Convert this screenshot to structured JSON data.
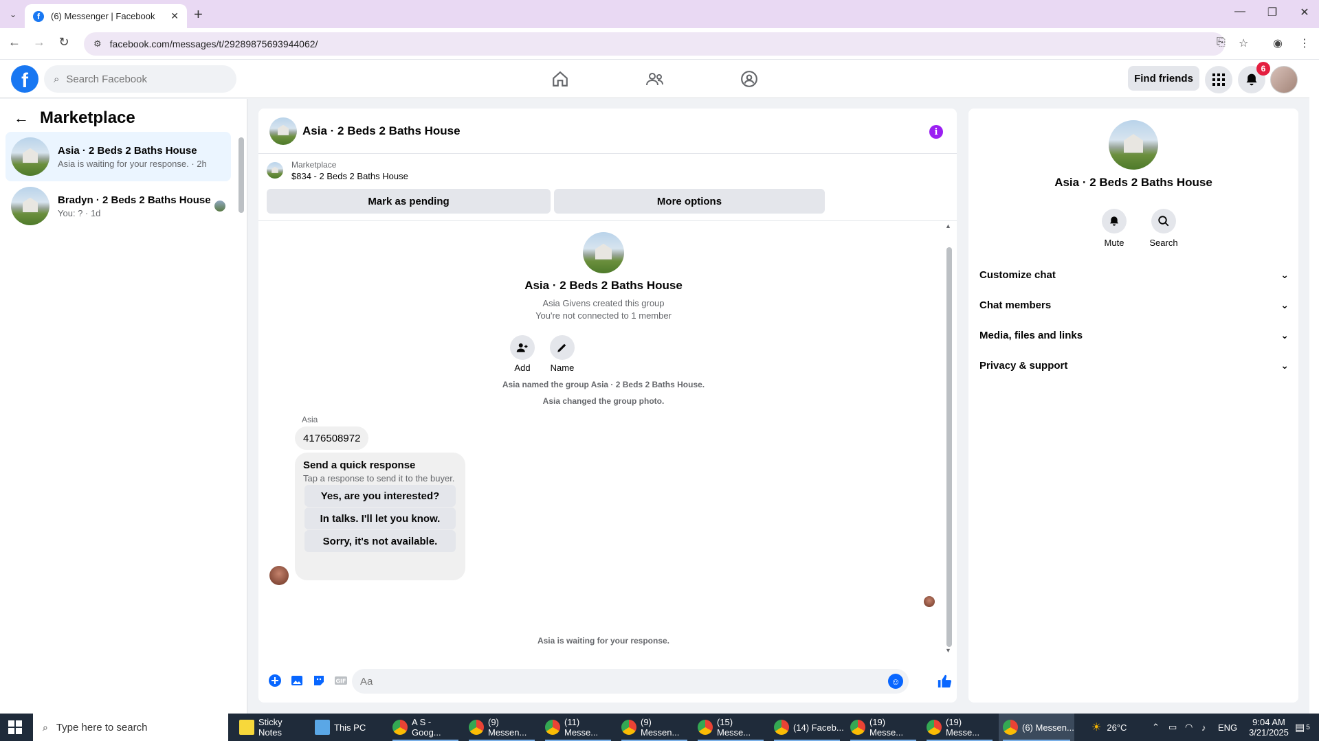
{
  "browser": {
    "tab_title": "(6) Messenger | Facebook",
    "url": "facebook.com/messages/t/29289875693944062/"
  },
  "fb_header": {
    "search_placeholder": "Search Facebook",
    "find_friends": "Find friends",
    "notification_count": "6"
  },
  "left_panel": {
    "title": "Marketplace",
    "conversations": [
      {
        "name": "Asia · 2 Beds 2 Baths House",
        "preview": "Asia is waiting for your response. · 2h"
      },
      {
        "name": "Bradyn · 2 Beds 2 Baths House",
        "preview": "You: ? · 1d"
      }
    ]
  },
  "chat": {
    "title": "Asia · 2 Beds 2 Baths House",
    "marketplace_label": "Marketplace",
    "listing": "$834 - 2 Beds 2 Baths House",
    "mark_pending": "Mark as pending",
    "more_options": "More options",
    "group_title": "Asia · 2 Beds 2 Baths House",
    "created_by": "Asia Givens created this group",
    "not_connected": "You're not connected to 1 member",
    "add_label": "Add",
    "name_label": "Name",
    "sys_named": "Asia named the group Asia · 2 Beds 2 Baths House.",
    "sys_photo": "Asia changed the group photo.",
    "sender": "Asia",
    "message": "4176508972",
    "quick_title": "Send a quick response",
    "quick_sub": "Tap a response to send it to the buyer.",
    "quick_responses": [
      "Yes, are you interested?",
      "In talks. I'll let you know.",
      "Sorry, it's not available."
    ],
    "waiting": "Asia is waiting for your response.",
    "composer_placeholder": "Aa"
  },
  "info_panel": {
    "title": "Asia · 2 Beds 2 Baths House",
    "mute": "Mute",
    "search": "Search",
    "sections": [
      "Customize chat",
      "Chat members",
      "Media, files and links",
      "Privacy & support"
    ]
  },
  "taskbar": {
    "search_placeholder": "Type here to search",
    "items": [
      "Sticky Notes",
      "This PC",
      "A S - Goog...",
      "(9) Messen...",
      "(11) Messe...",
      "(9) Messen...",
      "(15) Messe...",
      "(14) Faceb...",
      "(19) Messe...",
      "(19) Messe...",
      "(6) Messen..."
    ],
    "temperature": "26°C",
    "language": "ENG",
    "time": "9:04 AM",
    "date": "3/21/2025",
    "notifications": "5"
  }
}
